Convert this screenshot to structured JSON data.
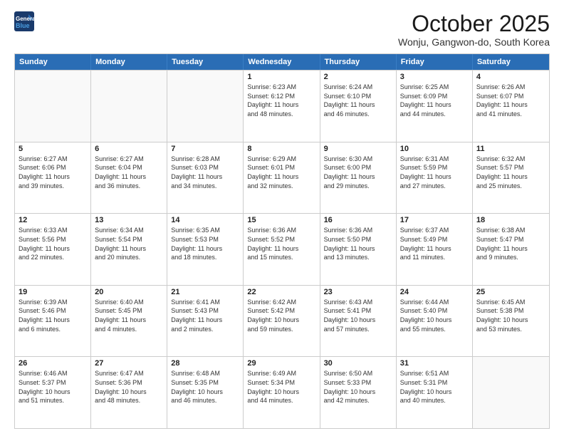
{
  "header": {
    "logo_line1": "General",
    "logo_line2": "Blue",
    "month_title": "October 2025",
    "location": "Wonju, Gangwon-do, South Korea"
  },
  "weekdays": [
    "Sunday",
    "Monday",
    "Tuesday",
    "Wednesday",
    "Thursday",
    "Friday",
    "Saturday"
  ],
  "rows": [
    [
      {
        "day": "",
        "empty": true
      },
      {
        "day": "",
        "empty": true
      },
      {
        "day": "",
        "empty": true
      },
      {
        "day": "1",
        "info": "Sunrise: 6:23 AM\nSunset: 6:12 PM\nDaylight: 11 hours\nand 48 minutes."
      },
      {
        "day": "2",
        "info": "Sunrise: 6:24 AM\nSunset: 6:10 PM\nDaylight: 11 hours\nand 46 minutes."
      },
      {
        "day": "3",
        "info": "Sunrise: 6:25 AM\nSunset: 6:09 PM\nDaylight: 11 hours\nand 44 minutes."
      },
      {
        "day": "4",
        "info": "Sunrise: 6:26 AM\nSunset: 6:07 PM\nDaylight: 11 hours\nand 41 minutes."
      }
    ],
    [
      {
        "day": "5",
        "info": "Sunrise: 6:27 AM\nSunset: 6:06 PM\nDaylight: 11 hours\nand 39 minutes."
      },
      {
        "day": "6",
        "info": "Sunrise: 6:27 AM\nSunset: 6:04 PM\nDaylight: 11 hours\nand 36 minutes."
      },
      {
        "day": "7",
        "info": "Sunrise: 6:28 AM\nSunset: 6:03 PM\nDaylight: 11 hours\nand 34 minutes."
      },
      {
        "day": "8",
        "info": "Sunrise: 6:29 AM\nSunset: 6:01 PM\nDaylight: 11 hours\nand 32 minutes."
      },
      {
        "day": "9",
        "info": "Sunrise: 6:30 AM\nSunset: 6:00 PM\nDaylight: 11 hours\nand 29 minutes."
      },
      {
        "day": "10",
        "info": "Sunrise: 6:31 AM\nSunset: 5:59 PM\nDaylight: 11 hours\nand 27 minutes."
      },
      {
        "day": "11",
        "info": "Sunrise: 6:32 AM\nSunset: 5:57 PM\nDaylight: 11 hours\nand 25 minutes."
      }
    ],
    [
      {
        "day": "12",
        "info": "Sunrise: 6:33 AM\nSunset: 5:56 PM\nDaylight: 11 hours\nand 22 minutes."
      },
      {
        "day": "13",
        "info": "Sunrise: 6:34 AM\nSunset: 5:54 PM\nDaylight: 11 hours\nand 20 minutes."
      },
      {
        "day": "14",
        "info": "Sunrise: 6:35 AM\nSunset: 5:53 PM\nDaylight: 11 hours\nand 18 minutes."
      },
      {
        "day": "15",
        "info": "Sunrise: 6:36 AM\nSunset: 5:52 PM\nDaylight: 11 hours\nand 15 minutes."
      },
      {
        "day": "16",
        "info": "Sunrise: 6:36 AM\nSunset: 5:50 PM\nDaylight: 11 hours\nand 13 minutes."
      },
      {
        "day": "17",
        "info": "Sunrise: 6:37 AM\nSunset: 5:49 PM\nDaylight: 11 hours\nand 11 minutes."
      },
      {
        "day": "18",
        "info": "Sunrise: 6:38 AM\nSunset: 5:47 PM\nDaylight: 11 hours\nand 9 minutes."
      }
    ],
    [
      {
        "day": "19",
        "info": "Sunrise: 6:39 AM\nSunset: 5:46 PM\nDaylight: 11 hours\nand 6 minutes."
      },
      {
        "day": "20",
        "info": "Sunrise: 6:40 AM\nSunset: 5:45 PM\nDaylight: 11 hours\nand 4 minutes."
      },
      {
        "day": "21",
        "info": "Sunrise: 6:41 AM\nSunset: 5:43 PM\nDaylight: 11 hours\nand 2 minutes."
      },
      {
        "day": "22",
        "info": "Sunrise: 6:42 AM\nSunset: 5:42 PM\nDaylight: 10 hours\nand 59 minutes."
      },
      {
        "day": "23",
        "info": "Sunrise: 6:43 AM\nSunset: 5:41 PM\nDaylight: 10 hours\nand 57 minutes."
      },
      {
        "day": "24",
        "info": "Sunrise: 6:44 AM\nSunset: 5:40 PM\nDaylight: 10 hours\nand 55 minutes."
      },
      {
        "day": "25",
        "info": "Sunrise: 6:45 AM\nSunset: 5:38 PM\nDaylight: 10 hours\nand 53 minutes."
      }
    ],
    [
      {
        "day": "26",
        "info": "Sunrise: 6:46 AM\nSunset: 5:37 PM\nDaylight: 10 hours\nand 51 minutes."
      },
      {
        "day": "27",
        "info": "Sunrise: 6:47 AM\nSunset: 5:36 PM\nDaylight: 10 hours\nand 48 minutes."
      },
      {
        "day": "28",
        "info": "Sunrise: 6:48 AM\nSunset: 5:35 PM\nDaylight: 10 hours\nand 46 minutes."
      },
      {
        "day": "29",
        "info": "Sunrise: 6:49 AM\nSunset: 5:34 PM\nDaylight: 10 hours\nand 44 minutes."
      },
      {
        "day": "30",
        "info": "Sunrise: 6:50 AM\nSunset: 5:33 PM\nDaylight: 10 hours\nand 42 minutes."
      },
      {
        "day": "31",
        "info": "Sunrise: 6:51 AM\nSunset: 5:31 PM\nDaylight: 10 hours\nand 40 minutes."
      },
      {
        "day": "",
        "empty": true
      }
    ]
  ]
}
